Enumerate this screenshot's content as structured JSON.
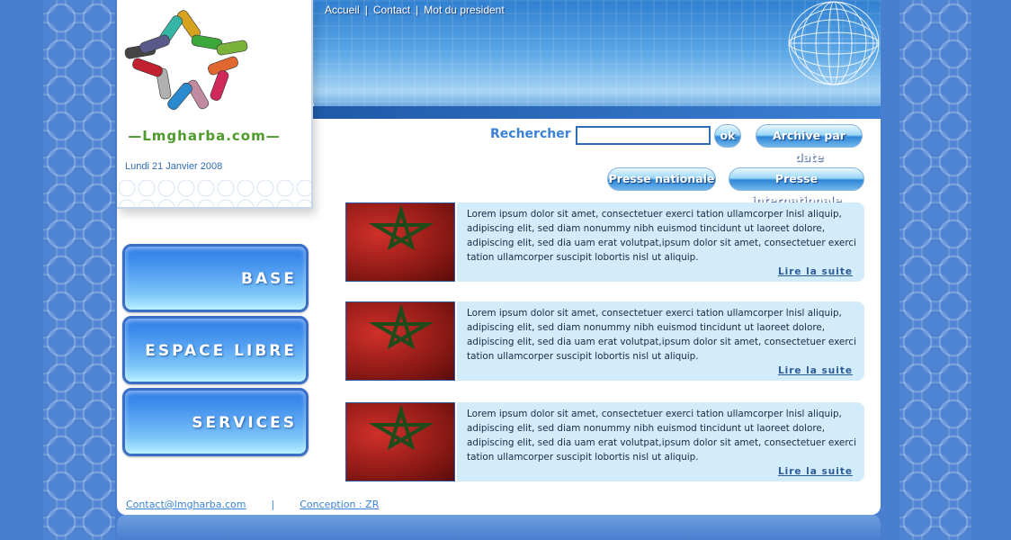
{
  "header": {
    "nav": [
      "Accueil",
      "Contact",
      "Mot du president"
    ],
    "nav_separator": "|"
  },
  "brand": {
    "site_name": "—Lmgharba.com—",
    "date": "Lundi 21 Janvier 2008"
  },
  "menu": {
    "items": [
      "BASE",
      "ESPACE LIBRE",
      "SERVICES"
    ]
  },
  "search": {
    "label": "Rechercher :",
    "value": "",
    "ok_label": "ok",
    "archive_label": "Archive par date"
  },
  "press": {
    "national_label": "Presse nationale",
    "international_label": "Presse internationale"
  },
  "articles": [
    {
      "text": "Lorem ipsum dolor sit amet, consectetuer exerci tation ullamcorper lnisl aliquip, adipiscing elit, sed diam nonummy nibh euismod tincidunt ut laoreet dolore, adipiscing elit, sed dia uam erat volutpat,ipsum dolor sit amet, consectetuer exerci tation ullamcorper suscipit lobortis nisl ut aliquip.",
      "more": "Lire la suite"
    },
    {
      "text": "Lorem ipsum dolor sit amet, consectetuer exerci tation ullamcorper lnisl aliquip, adipiscing elit, sed diam nonummy nibh euismod tincidunt ut laoreet dolore, adipiscing elit, sed dia uam erat volutpat,ipsum dolor sit amet, consectetuer exerci tation ullamcorper suscipit lobortis nisl ut aliquip.",
      "more": "Lire la suite"
    },
    {
      "text": "Lorem ipsum dolor sit amet, consectetuer exerci tation ullamcorper lnisl aliquip, adipiscing elit, sed diam nonummy nibh euismod tincidunt ut laoreet dolore, adipiscing elit, sed dia uam erat volutpat,ipsum dolor sit amet, consectetuer exerci tation ullamcorper suscipit lobortis nisl ut aliquip.",
      "more": "Lire la suite"
    }
  ],
  "footer": {
    "contact": "Contact@lmgharba.com",
    "separator": "|",
    "credit": "Conception : ZR"
  },
  "colors": {
    "background": "#4a7fcf",
    "accent": "#3a82d8",
    "brand_green": "#4e9a2a",
    "article_bg": "#d3ecfb"
  },
  "icons": [
    "star-people-logo-icon",
    "globe-icon",
    "moroccan-flag-image"
  ]
}
